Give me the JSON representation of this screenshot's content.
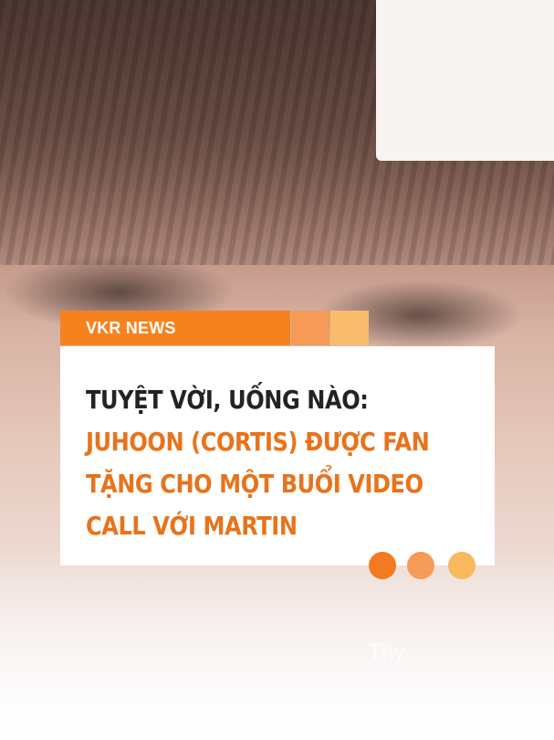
{
  "source_tag": "VKR NEWS",
  "headline": {
    "dark_part": "TUYỆT VỜI, UỐNG NÀO: ",
    "orange_part": "JUHOON (CORTIS) ĐƯỢC FAN TẶNG CHO MỘT BUỔI VIDEO CALL VỚI MARTIN"
  },
  "watermark": "Thy",
  "colors": {
    "brand_orange": "#f6821f",
    "headline_orange": "#e8731b",
    "accent_peach": "#f59a57",
    "accent_yellow": "#f8b85c",
    "headline_dark": "#232323"
  }
}
